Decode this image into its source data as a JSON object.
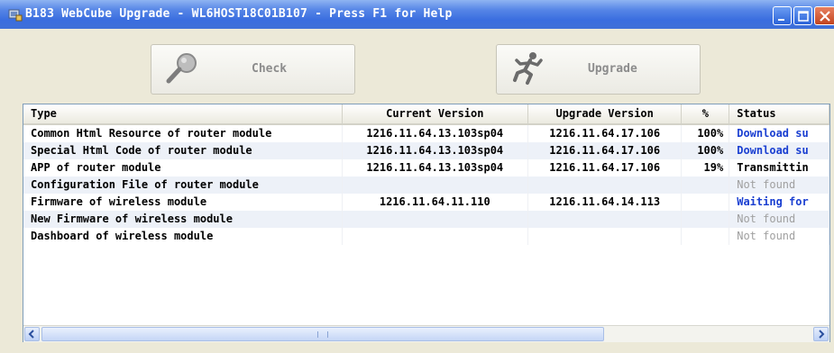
{
  "window": {
    "title": "B183 WebCube Upgrade - WL6HOST18C01B107 - Press F1 for Help",
    "icon": "app-icon"
  },
  "toolbar": {
    "check_label": "Check",
    "check_icon": "magnifier-icon",
    "upgrade_label": "Upgrade",
    "upgrade_icon": "running-man-icon"
  },
  "table": {
    "columns": [
      "Type",
      "Current Version",
      "Upgrade Version",
      "%",
      "Status"
    ],
    "rows": [
      {
        "type": "Common Html Resource of router module",
        "current": "1216.11.64.13.103sp04",
        "upgrade": "1216.11.64.17.106",
        "percent": "100%",
        "status": "Download su",
        "status_kind": "done"
      },
      {
        "type": "Special Html Code of router module",
        "current": "1216.11.64.13.103sp04",
        "upgrade": "1216.11.64.17.106",
        "percent": "100%",
        "status": "Download su",
        "status_kind": "done"
      },
      {
        "type": "APP of router module",
        "current": "1216.11.64.13.103sp04",
        "upgrade": "1216.11.64.17.106",
        "percent": "19%",
        "status": "Transmittin",
        "status_kind": "active"
      },
      {
        "type": "Configuration File of router module",
        "current": "",
        "upgrade": "",
        "percent": "",
        "status": "Not found",
        "status_kind": "missing"
      },
      {
        "type": "Firmware of wireless module",
        "current": "1216.11.64.11.110",
        "upgrade": "1216.11.64.14.113",
        "percent": "",
        "status": "Waiting for",
        "status_kind": "waiting"
      },
      {
        "type": "New Firmware of wireless module",
        "current": "",
        "upgrade": "",
        "percent": "",
        "status": "Not found",
        "status_kind": "missing"
      },
      {
        "type": "Dashboard of wireless module",
        "current": "",
        "upgrade": "",
        "percent": "",
        "status": "Not found",
        "status_kind": "missing"
      }
    ]
  },
  "colors": {
    "done": "#1a3fd1",
    "waiting": "#1a3fd1",
    "active": "#000000",
    "missing": "#a0a0a0"
  }
}
